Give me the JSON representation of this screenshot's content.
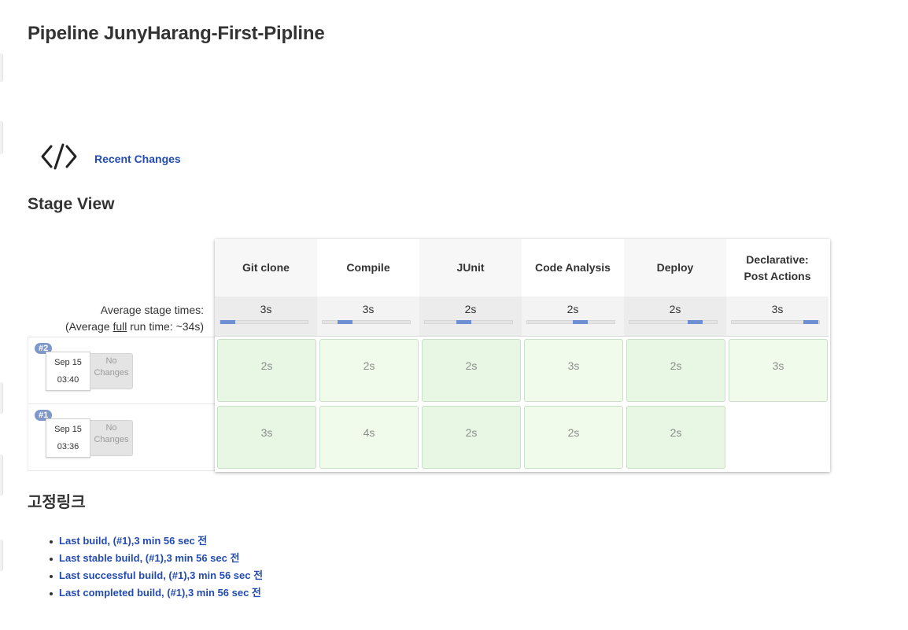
{
  "page_title": "Pipeline JunyHarang-First-Pipline",
  "recent_changes": {
    "label": "Recent Changes",
    "icon": "code-icon"
  },
  "stage_view": {
    "heading": "Stage View",
    "avg_label_line1": "Average stage times:",
    "avg_label_prefix": "(Average ",
    "avg_label_full": "full",
    "avg_label_suffix": " run time: ~34s)",
    "stages": [
      {
        "name_line1": "Git clone",
        "name_line2": "",
        "avg": "3s",
        "bar_fraction_start": 0.0
      },
      {
        "name_line1": "Compile",
        "name_line2": "",
        "avg": "3s",
        "bar_fraction_start": 0.17
      },
      {
        "name_line1": "JUnit",
        "name_line2": "",
        "avg": "2s",
        "bar_fraction_start": 0.36
      },
      {
        "name_line1": "Code Analysis",
        "name_line2": "",
        "avg": "2s",
        "bar_fraction_start": 0.52
      },
      {
        "name_line1": "Deploy",
        "name_line2": "",
        "avg": "2s",
        "bar_fraction_start": 0.67
      },
      {
        "name_line1": "Declarative:",
        "name_line2": "Post Actions",
        "avg": "3s",
        "bar_fraction_start": 0.82
      }
    ],
    "builds": [
      {
        "number": "#2",
        "date": "Sep 15",
        "time": "03:40",
        "changes_line1": "No",
        "changes_line2": "Changes",
        "durations": [
          "2s",
          "2s",
          "2s",
          "3s",
          "2s",
          "3s"
        ]
      },
      {
        "number": "#1",
        "date": "Sep 15",
        "time": "03:36",
        "changes_line1": "No",
        "changes_line2": "Changes",
        "durations": [
          "3s",
          "4s",
          "2s",
          "2s",
          "2s",
          ""
        ]
      }
    ]
  },
  "permalinks": {
    "heading": "고정링크",
    "items": [
      "Last build, (#1),3 min 56 sec 전",
      "Last stable build, (#1),3 min 56 sec 전",
      "Last successful build, (#1),3 min 56 sec 전",
      "Last completed build, (#1),3 min 56 sec 전"
    ]
  },
  "colors": {
    "link": "#234bb0",
    "success_cell": "#e8f6e4",
    "success_cell_alt": "#f0fbec",
    "bar_fill": "#6e90d3",
    "badge": "#7d98c9"
  }
}
